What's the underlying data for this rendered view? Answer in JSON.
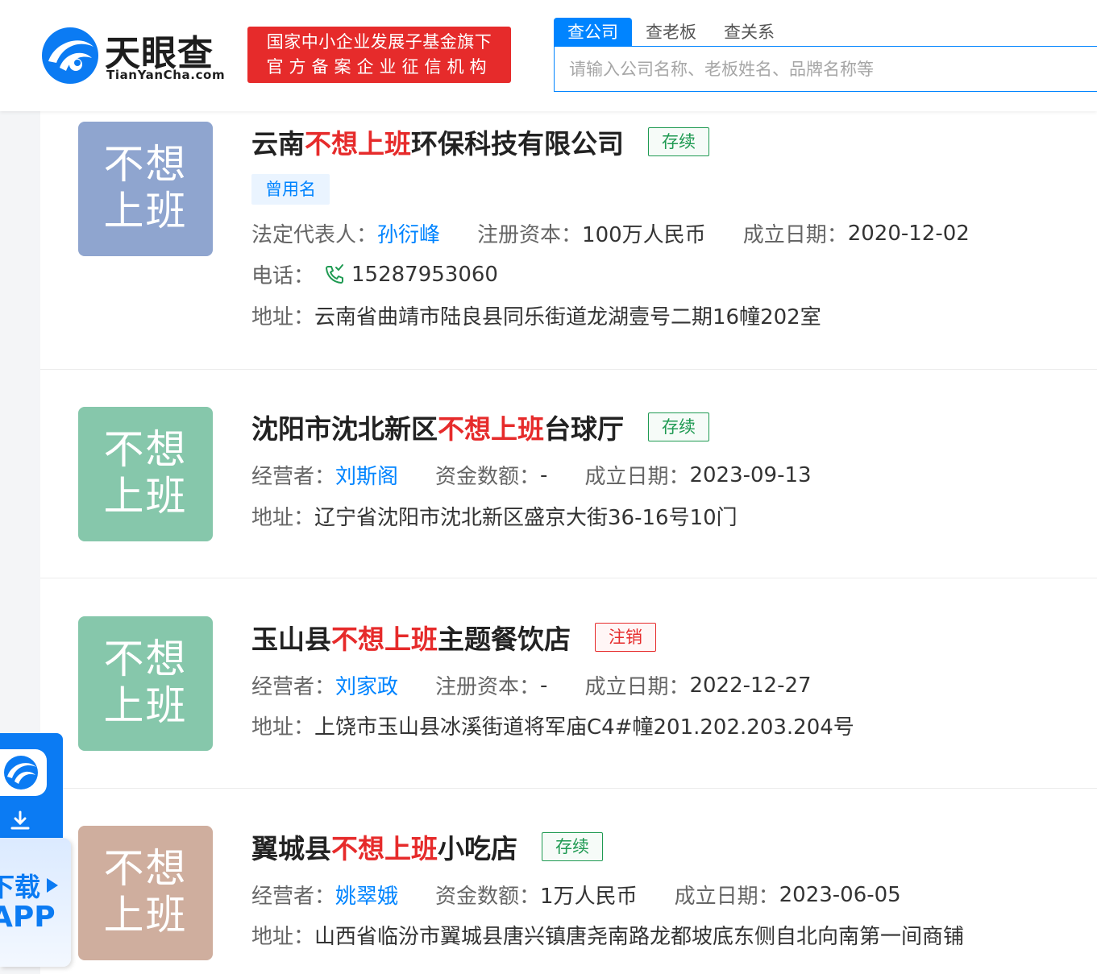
{
  "header": {
    "logo_cn": "天眼查",
    "logo_en": "TianYanCha.com",
    "slogan_line1": "国家中小企业发展子基金旗下",
    "slogan_line2": "官方备案企业征信机构",
    "tabs": [
      {
        "label": "查公司"
      },
      {
        "label": "查老板"
      },
      {
        "label": "查关系"
      }
    ],
    "search_placeholder": "请输入公司名称、老板姓名、品牌名称等"
  },
  "colors": {
    "accent": "#0084ff",
    "highlight": "#e62b2b",
    "status_ok": "#1f9a52"
  },
  "results": [
    {
      "avatar_line1": "不想",
      "avatar_line2": "上班",
      "avatar_color": "#8fa5cf",
      "title_pre": "云南",
      "title_hl": "不想上班",
      "title_post": "环保科技有限公司",
      "status": "存续",
      "tag": "曾用名",
      "f1_label": "法定代表人：",
      "f1_value": "孙衍峰",
      "f2_label": "注册资本：",
      "f2_value": "100万人民币",
      "f3_label": "成立日期：",
      "f3_value": "2020-12-02",
      "phone_label": "电话：",
      "phone_value": "15287953060",
      "addr_label": "地址：",
      "addr_value": "云南省曲靖市陆良县同乐街道龙湖壹号二期16幢202室"
    },
    {
      "avatar_line1": "不想",
      "avatar_line2": "上班",
      "avatar_color": "#86c7ab",
      "title_pre": "沈阳市沈北新区",
      "title_hl": "不想上班",
      "title_post": "台球厅",
      "status": "存续",
      "f1_label": "经营者：",
      "f1_value": "刘斯阁",
      "f2_label": "资金数额：",
      "f2_value": "-",
      "f3_label": "成立日期：",
      "f3_value": "2023-09-13",
      "addr_label": "地址：",
      "addr_value": "辽宁省沈阳市沈北新区盛京大街36-16号10门"
    },
    {
      "avatar_line1": "不想",
      "avatar_line2": "上班",
      "avatar_color": "#86c7ab",
      "title_pre": "玉山县",
      "title_hl": "不想上班",
      "title_post": "主题餐饮店",
      "status": "注销",
      "f1_label": "经营者：",
      "f1_value": "刘家政",
      "f2_label": "注册资本：",
      "f2_value": "-",
      "f3_label": "成立日期：",
      "f3_value": "2022-12-27",
      "addr_label": "地址：",
      "addr_value": "上饶市玉山县冰溪街道将军庙C4#幢201.202.203.204号"
    },
    {
      "avatar_line1": "不想",
      "avatar_line2": "上班",
      "avatar_color": "#cfae9e",
      "title_pre": "翼城县",
      "title_hl": "不想上班",
      "title_post": "小吃店",
      "status": "存续",
      "f1_label": "经营者：",
      "f1_value": "姚翠娥",
      "f2_label": "资金数额：",
      "f2_value": "1万人民币",
      "f3_label": "成立日期：",
      "f3_value": "2023-06-05",
      "addr_label": "地址：",
      "addr_value": "山西省临汾市翼城县唐兴镇唐尧南路龙都坡底东侧自北向南第一间商铺"
    }
  ],
  "app_float": {
    "text1": "下载",
    "text2": "APP"
  }
}
